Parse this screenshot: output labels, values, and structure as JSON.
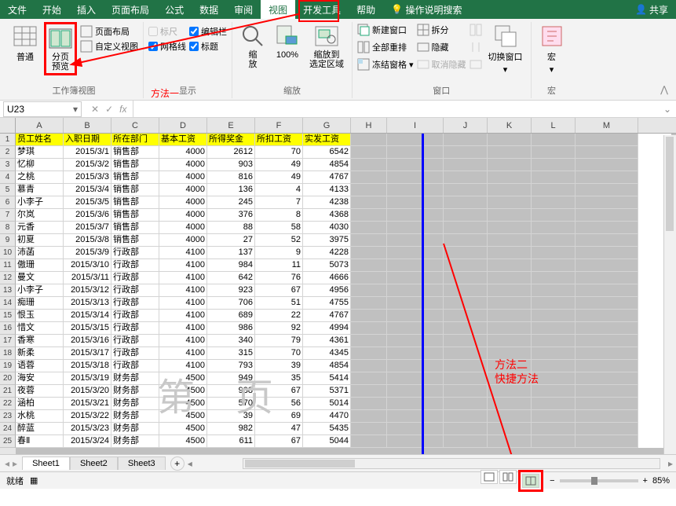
{
  "tabs": [
    "文件",
    "开始",
    "插入",
    "页面布局",
    "公式",
    "数据",
    "审阅",
    "视图",
    "开发工具",
    "帮助"
  ],
  "active_tab": "视图",
  "tellme": "操作说明搜索",
  "share": "共享",
  "ribbon": {
    "views": {
      "normal": "普通",
      "page_break": "分页\n预览",
      "page_layout": "页面布局",
      "custom": "自定义视图",
      "group": "工作簿视图"
    },
    "show": {
      "ruler": "编辑栏",
      "gridlines": "网格线",
      "headings": "标题",
      "group": "显示"
    },
    "zoom": {
      "zoom": "缩\n放",
      "pct": "100%",
      "selection": "缩放到\n选定区域",
      "group": "缩放"
    },
    "window": {
      "new": "新建窗口",
      "arrange": "全部重排",
      "freeze": "冻结窗格",
      "split": "拆分",
      "hide": "隐藏",
      "unhide": "取消隐藏",
      "switch": "切换窗口",
      "group": "窗口"
    },
    "macros": {
      "macro": "宏",
      "group": "宏"
    }
  },
  "annotations": {
    "m1": "方法一",
    "m2a": "方法二",
    "m2b": "快捷方法"
  },
  "namebox": "U23",
  "columns": [
    "A",
    "B",
    "C",
    "D",
    "E",
    "F",
    "G",
    "H",
    "I",
    "J",
    "K",
    "L",
    "M"
  ],
  "headers": [
    "员工姓名",
    "入职日期",
    "所在部门",
    "基本工资",
    "所得奖金",
    "所扣工资",
    "实发工资"
  ],
  "rows": [
    [
      "梦琪",
      "2015/3/1",
      "销售部",
      "4000",
      "2612",
      "70",
      "6542"
    ],
    [
      "忆柳",
      "2015/3/2",
      "销售部",
      "4000",
      "903",
      "49",
      "4854"
    ],
    [
      "之桃",
      "2015/3/3",
      "销售部",
      "4000",
      "816",
      "49",
      "4767"
    ],
    [
      "慕青",
      "2015/3/4",
      "销售部",
      "4000",
      "136",
      "4",
      "4133"
    ],
    [
      "小李子",
      "2015/3/5",
      "销售部",
      "4000",
      "245",
      "7",
      "4238"
    ],
    [
      "尔岚",
      "2015/3/6",
      "销售部",
      "4000",
      "376",
      "8",
      "4368"
    ],
    [
      "元香",
      "2015/3/7",
      "销售部",
      "4000",
      "88",
      "58",
      "4030"
    ],
    [
      "初夏",
      "2015/3/8",
      "销售部",
      "4000",
      "27",
      "52",
      "3975"
    ],
    [
      "沛菡",
      "2015/3/9",
      "行政部",
      "4100",
      "137",
      "9",
      "4228"
    ],
    [
      "傲珊",
      "2015/3/10",
      "行政部",
      "4100",
      "984",
      "11",
      "5073"
    ],
    [
      "曼文",
      "2015/3/11",
      "行政部",
      "4100",
      "642",
      "76",
      "4666"
    ],
    [
      "小李子",
      "2015/3/12",
      "行政部",
      "4100",
      "923",
      "67",
      "4956"
    ],
    [
      "痴珊",
      "2015/3/13",
      "行政部",
      "4100",
      "706",
      "51",
      "4755"
    ],
    [
      "恨玉",
      "2015/3/14",
      "行政部",
      "4100",
      "689",
      "22",
      "4767"
    ],
    [
      "惜文",
      "2015/3/15",
      "行政部",
      "4100",
      "986",
      "92",
      "4994"
    ],
    [
      "香寒",
      "2015/3/16",
      "行政部",
      "4100",
      "340",
      "79",
      "4361"
    ],
    [
      "新柔",
      "2015/3/17",
      "行政部",
      "4100",
      "315",
      "70",
      "4345"
    ],
    [
      "语蓉",
      "2015/3/18",
      "行政部",
      "4100",
      "793",
      "39",
      "4854"
    ],
    [
      "海安",
      "2015/3/19",
      "财务部",
      "4500",
      "949",
      "35",
      "5414"
    ],
    [
      "夜蓉",
      "2015/3/20",
      "财务部",
      "4500",
      "938",
      "67",
      "5371"
    ],
    [
      "涵柏",
      "2015/3/21",
      "财务部",
      "4500",
      "570",
      "56",
      "5014"
    ],
    [
      "水桃",
      "2015/3/22",
      "财务部",
      "4500",
      "39",
      "69",
      "4470"
    ],
    [
      "醉蓝",
      "2015/3/23",
      "财务部",
      "4500",
      "982",
      "47",
      "5435"
    ],
    [
      "春Ⅱ",
      "2015/3/24",
      "财务部",
      "4500",
      "611",
      "67",
      "5044"
    ]
  ],
  "watermark": "第 页",
  "sheets": [
    "Sheet1",
    "Sheet2",
    "Sheet3"
  ],
  "status": {
    "ready": "就绪",
    "zoom": "85%"
  }
}
